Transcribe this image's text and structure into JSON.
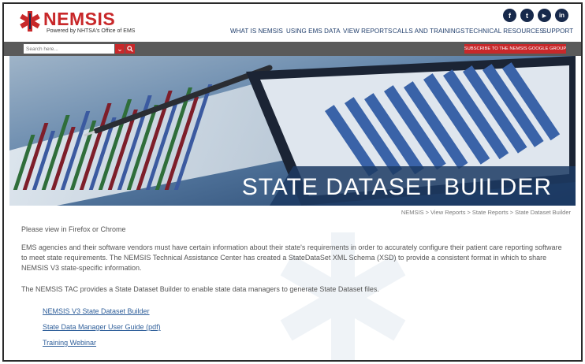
{
  "brand": {
    "name": "NEMSIS",
    "tagline": "Powered by NHTSA's Office of EMS"
  },
  "social": [
    {
      "icon": "facebook-icon",
      "glyph": "f"
    },
    {
      "icon": "twitter-icon",
      "glyph": "t"
    },
    {
      "icon": "youtube-icon",
      "glyph": "▶"
    },
    {
      "icon": "linkedin-icon",
      "glyph": "in"
    }
  ],
  "nav": {
    "items": [
      "WHAT IS NEMSIS",
      "USING EMS DATA",
      "VIEW REPORTS",
      "CALLS AND TRAININGS",
      "TECHNICAL RESOURCES",
      "SUPPORT"
    ]
  },
  "search": {
    "placeholder": "Search here..."
  },
  "subscribe_label": "SUBSCRIBE TO THE NEMSIS GOOGLE GROUP",
  "hero": {
    "title": "STATE DATASET BUILDER"
  },
  "breadcrumb": [
    "NEMSIS",
    "View Reports",
    "State Reports",
    "State Dataset Builder"
  ],
  "breadcrumb_sep": ">",
  "content": {
    "notice": "Please view in Firefox or Chrome",
    "paragraph1": "EMS agencies and their software vendors must have certain information about their state's requirements in order to accurately configure their patient care reporting software to meet state requirements. The NEMSIS Technical Assistance Center has created a StateDataSet XML Schema (XSD) to provide a consistent format in which to share NEMSIS V3 state-specific information.",
    "paragraph2": "The NEMSIS TAC provides a State Dataset Builder to enable state data managers to generate State Dataset files.",
    "links": [
      "NEMSIS V3 State Dataset Builder",
      "State Data Manager User Guide (pdf)",
      "Training Webinar"
    ]
  },
  "colors": {
    "brand_red": "#c8282a",
    "navy": "#17294b",
    "nav_text": "#1f3d6b",
    "link": "#2f5f9a",
    "search_strip": "#5a5a5a"
  }
}
